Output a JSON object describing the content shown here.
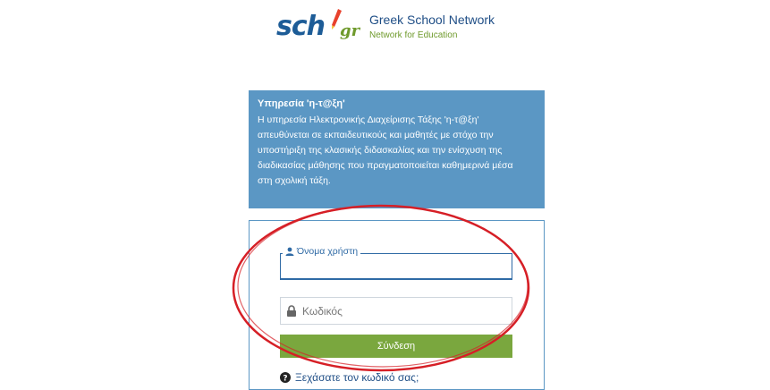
{
  "logo": {
    "sch": "sch",
    "gr": "gr",
    "title": "Greek School Network",
    "subtitle": "Network for Education"
  },
  "info": {
    "title": "Υπηρεσία 'η-τ@ξη'",
    "lines": [
      "Η υπηρεσία Ηλεκτρονικής Διαχείρισης Τάξης 'η-τ@ξη'",
      "απευθύνεται σε εκπαιδευτικούς και μαθητές με στόχο την",
      "υποστήριξη της κλασικής διδασκαλίας και την ενίσχυση της",
      "διαδικασίας μάθησης που πραγματοποιείται καθημερινά μέσα",
      "στη σχολική τάξη."
    ]
  },
  "login": {
    "username_label": "Όνομα χρήστη",
    "username_value": "",
    "password_placeholder": "Κωδικός",
    "submit_label": "Σύνδεση",
    "forgot_label": "Ξεχάσατε τον κωδικό σας;"
  },
  "colors": {
    "info_bg": "#5b97c4",
    "button": "#7aa73e",
    "annotation_ellipse": "#d61f26"
  },
  "icons": {
    "user": "user-icon",
    "lock": "lock-icon",
    "help": "question-circle-icon",
    "pencil": "pencil-icon"
  }
}
